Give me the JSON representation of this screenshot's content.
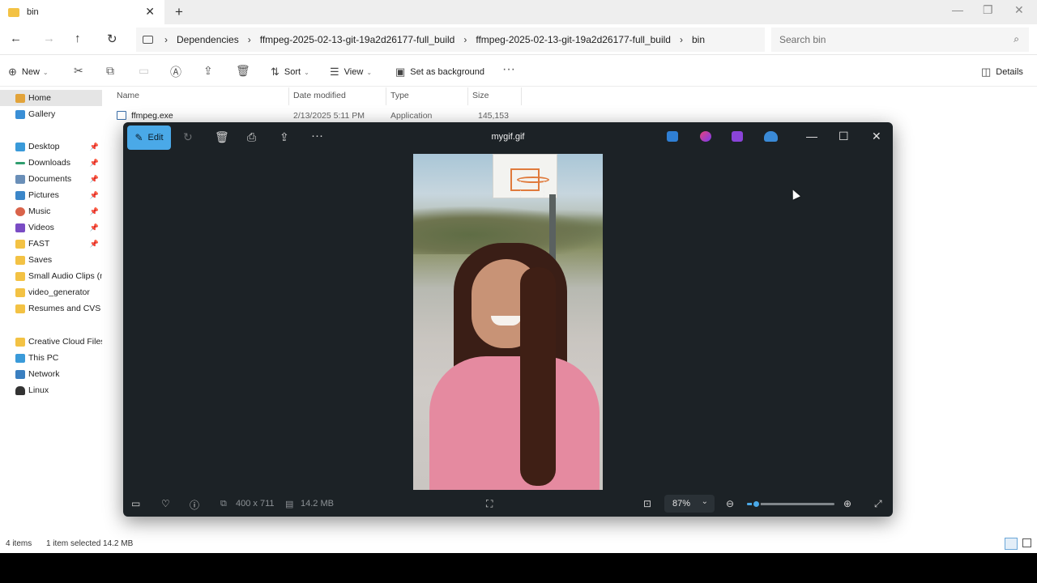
{
  "explorer": {
    "tab_title": "bin",
    "breadcrumb": [
      "Dependencies",
      "ffmpeg-2025-02-13-git-19a2d26177-full_build",
      "ffmpeg-2025-02-13-git-19a2d26177-full_build",
      "bin"
    ],
    "search_placeholder": "Search bin",
    "toolbar": {
      "new_label": "New",
      "sort_label": "Sort",
      "view_label": "View",
      "set_bg_label": "Set as background",
      "details_label": "Details"
    },
    "sidebar": {
      "items": [
        "Home",
        "Gallery",
        "Desktop",
        "Downloads",
        "Documents",
        "Pictures",
        "Music",
        "Videos",
        "FAST",
        "Saves",
        "Small Audio Clips (m",
        "video_generator",
        "Resumes and CVS",
        "Creative Cloud Files",
        "This PC",
        "Network",
        "Linux"
      ]
    },
    "columns": [
      "Name",
      "Date modified",
      "Type",
      "Size"
    ],
    "file": {
      "name": "ffmpeg.exe",
      "date": "2/13/2025 5:11 PM",
      "type": "Application",
      "size": "145,153 KB"
    },
    "status": {
      "count": "4 items",
      "selected": "1 item selected",
      "size": "14.2 MB"
    }
  },
  "viewer": {
    "title": "mygif.gif",
    "edit_label": "Edit",
    "dimensions": "400 x 711",
    "file_size": "14.2 MB",
    "zoom": "87%",
    "zoom_level": 0.1
  },
  "colors": {
    "accent": "#4aa9e8",
    "viewer_bg": "#1c2226"
  }
}
